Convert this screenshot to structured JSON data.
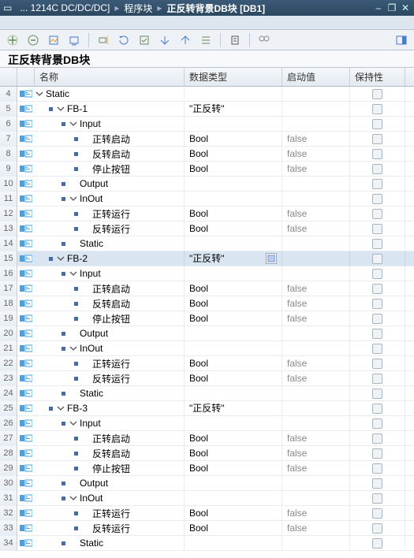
{
  "titlebar": {
    "crumb1": "... 1214C DC/DC/DC]",
    "crumb2": "程序块",
    "crumb3": "正反转背景DB块 [DB1]"
  },
  "block_title": "正反转背景DB块",
  "columns": {
    "name": "名称",
    "dtype": "数据类型",
    "start": "启动值",
    "retain": "保持性"
  },
  "rows": [
    {
      "n": 4,
      "d": 1,
      "lv": 0,
      "tw": "down",
      "b": 0,
      "name": "Static",
      "type": "",
      "start": "",
      "sel": false,
      "opt": false
    },
    {
      "n": 5,
      "d": 1,
      "lv": 1,
      "tw": "down",
      "b": 1,
      "name": "FB-1",
      "type": "\"正反转\"",
      "start": "",
      "sel": false,
      "opt": false
    },
    {
      "n": 6,
      "d": 1,
      "lv": 2,
      "tw": "down",
      "b": 1,
      "name": "Input",
      "type": "",
      "start": "",
      "sel": false,
      "opt": false
    },
    {
      "n": 7,
      "d": 1,
      "lv": 3,
      "tw": "",
      "b": 1,
      "name": "正转启动",
      "type": "Bool",
      "start": "false",
      "sel": false,
      "opt": false
    },
    {
      "n": 8,
      "d": 1,
      "lv": 3,
      "tw": "",
      "b": 1,
      "name": "反转启动",
      "type": "Bool",
      "start": "false",
      "sel": false,
      "opt": false
    },
    {
      "n": 9,
      "d": 1,
      "lv": 3,
      "tw": "",
      "b": 1,
      "name": "停止按钮",
      "type": "Bool",
      "start": "false",
      "sel": false,
      "opt": false
    },
    {
      "n": 10,
      "d": 1,
      "lv": 2,
      "tw": "",
      "b": 1,
      "name": "Output",
      "type": "",
      "start": "",
      "sel": false,
      "opt": false
    },
    {
      "n": 11,
      "d": 1,
      "lv": 2,
      "tw": "down",
      "b": 1,
      "name": "InOut",
      "type": "",
      "start": "",
      "sel": false,
      "opt": false
    },
    {
      "n": 12,
      "d": 1,
      "lv": 3,
      "tw": "",
      "b": 1,
      "name": "正转运行",
      "type": "Bool",
      "start": "false",
      "sel": false,
      "opt": false
    },
    {
      "n": 13,
      "d": 1,
      "lv": 3,
      "tw": "",
      "b": 1,
      "name": "反转运行",
      "type": "Bool",
      "start": "false",
      "sel": false,
      "opt": false
    },
    {
      "n": 14,
      "d": 1,
      "lv": 2,
      "tw": "",
      "b": 1,
      "name": "Static",
      "type": "",
      "start": "",
      "sel": false,
      "opt": false
    },
    {
      "n": 15,
      "d": 1,
      "lv": 1,
      "tw": "down",
      "b": 1,
      "name": "FB-2",
      "type": "\"正反转\"",
      "start": "",
      "sel": true,
      "opt": true
    },
    {
      "n": 16,
      "d": 1,
      "lv": 2,
      "tw": "down",
      "b": 1,
      "name": "Input",
      "type": "",
      "start": "",
      "sel": false,
      "opt": false
    },
    {
      "n": 17,
      "d": 1,
      "lv": 3,
      "tw": "",
      "b": 1,
      "name": "正转启动",
      "type": "Bool",
      "start": "false",
      "sel": false,
      "opt": false
    },
    {
      "n": 18,
      "d": 1,
      "lv": 3,
      "tw": "",
      "b": 1,
      "name": "反转启动",
      "type": "Bool",
      "start": "false",
      "sel": false,
      "opt": false
    },
    {
      "n": 19,
      "d": 1,
      "lv": 3,
      "tw": "",
      "b": 1,
      "name": "停止按钮",
      "type": "Bool",
      "start": "false",
      "sel": false,
      "opt": false
    },
    {
      "n": 20,
      "d": 1,
      "lv": 2,
      "tw": "",
      "b": 1,
      "name": "Output",
      "type": "",
      "start": "",
      "sel": false,
      "opt": false
    },
    {
      "n": 21,
      "d": 1,
      "lv": 2,
      "tw": "down",
      "b": 1,
      "name": "InOut",
      "type": "",
      "start": "",
      "sel": false,
      "opt": false
    },
    {
      "n": 22,
      "d": 1,
      "lv": 3,
      "tw": "",
      "b": 1,
      "name": "正转运行",
      "type": "Bool",
      "start": "false",
      "sel": false,
      "opt": false
    },
    {
      "n": 23,
      "d": 1,
      "lv": 3,
      "tw": "",
      "b": 1,
      "name": "反转运行",
      "type": "Bool",
      "start": "false",
      "sel": false,
      "opt": false
    },
    {
      "n": 24,
      "d": 1,
      "lv": 2,
      "tw": "",
      "b": 1,
      "name": "Static",
      "type": "",
      "start": "",
      "sel": false,
      "opt": false
    },
    {
      "n": 25,
      "d": 1,
      "lv": 1,
      "tw": "down",
      "b": 1,
      "name": "FB-3",
      "type": "\"正反转\"",
      "start": "",
      "sel": false,
      "opt": false
    },
    {
      "n": 26,
      "d": 1,
      "lv": 2,
      "tw": "down",
      "b": 1,
      "name": "Input",
      "type": "",
      "start": "",
      "sel": false,
      "opt": false
    },
    {
      "n": 27,
      "d": 1,
      "lv": 3,
      "tw": "",
      "b": 1,
      "name": "正转启动",
      "type": "Bool",
      "start": "false",
      "sel": false,
      "opt": false
    },
    {
      "n": 28,
      "d": 1,
      "lv": 3,
      "tw": "",
      "b": 1,
      "name": "反转启动",
      "type": "Bool",
      "start": "false",
      "sel": false,
      "opt": false
    },
    {
      "n": 29,
      "d": 1,
      "lv": 3,
      "tw": "",
      "b": 1,
      "name": "停止按钮",
      "type": "Bool",
      "start": "false",
      "sel": false,
      "opt": false
    },
    {
      "n": 30,
      "d": 1,
      "lv": 2,
      "tw": "",
      "b": 1,
      "name": "Output",
      "type": "",
      "start": "",
      "sel": false,
      "opt": false
    },
    {
      "n": 31,
      "d": 1,
      "lv": 2,
      "tw": "down",
      "b": 1,
      "name": "InOut",
      "type": "",
      "start": "",
      "sel": false,
      "opt": false
    },
    {
      "n": 32,
      "d": 1,
      "lv": 3,
      "tw": "",
      "b": 1,
      "name": "正转运行",
      "type": "Bool",
      "start": "false",
      "sel": false,
      "opt": false
    },
    {
      "n": 33,
      "d": 1,
      "lv": 3,
      "tw": "",
      "b": 1,
      "name": "反转运行",
      "type": "Bool",
      "start": "false",
      "sel": false,
      "opt": false
    },
    {
      "n": 34,
      "d": 1,
      "lv": 2,
      "tw": "",
      "b": 1,
      "name": "Static",
      "type": "",
      "start": "",
      "sel": false,
      "opt": false
    }
  ]
}
